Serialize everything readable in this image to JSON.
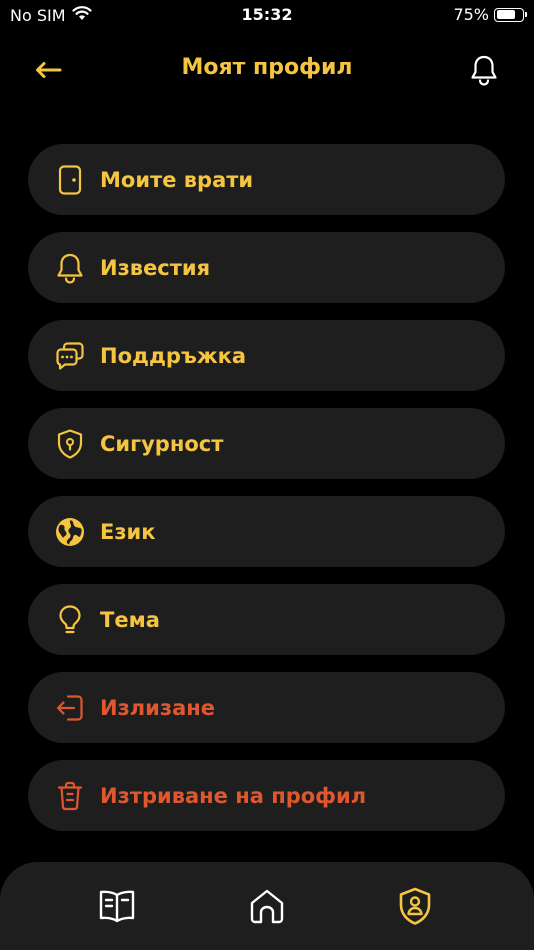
{
  "status_bar": {
    "carrier": "No SIM",
    "time": "15:32",
    "battery_text": "75%",
    "battery_level": 0.75
  },
  "header": {
    "title": "Моят профил",
    "back_icon": "arrow-left-icon",
    "notification_icon": "bell-icon"
  },
  "menu": {
    "items": [
      {
        "label": "Моите врати",
        "icon": "door-icon"
      },
      {
        "label": "Известия",
        "icon": "bell-icon"
      },
      {
        "label": "Поддръжка",
        "icon": "chat-bubbles-icon"
      },
      {
        "label": "Сигурност",
        "icon": "shield-lock-icon"
      },
      {
        "label": "Език",
        "icon": "globe-icon"
      },
      {
        "label": "Тема",
        "icon": "lightbulb-icon"
      },
      {
        "label": "Излизане",
        "icon": "logout-icon"
      },
      {
        "label": "Изтриване на профил",
        "icon": "trash-icon"
      }
    ]
  },
  "bottom_nav": {
    "items": [
      {
        "icon": "book-icon"
      },
      {
        "icon": "home-icon"
      },
      {
        "icon": "profile-shield-icon",
        "active": true
      }
    ]
  },
  "colors": {
    "accent": "#f5c542",
    "danger": "#e0572f",
    "background": "#000000",
    "card": "#1e1e1e",
    "inactive_icon": "#ffffff"
  }
}
